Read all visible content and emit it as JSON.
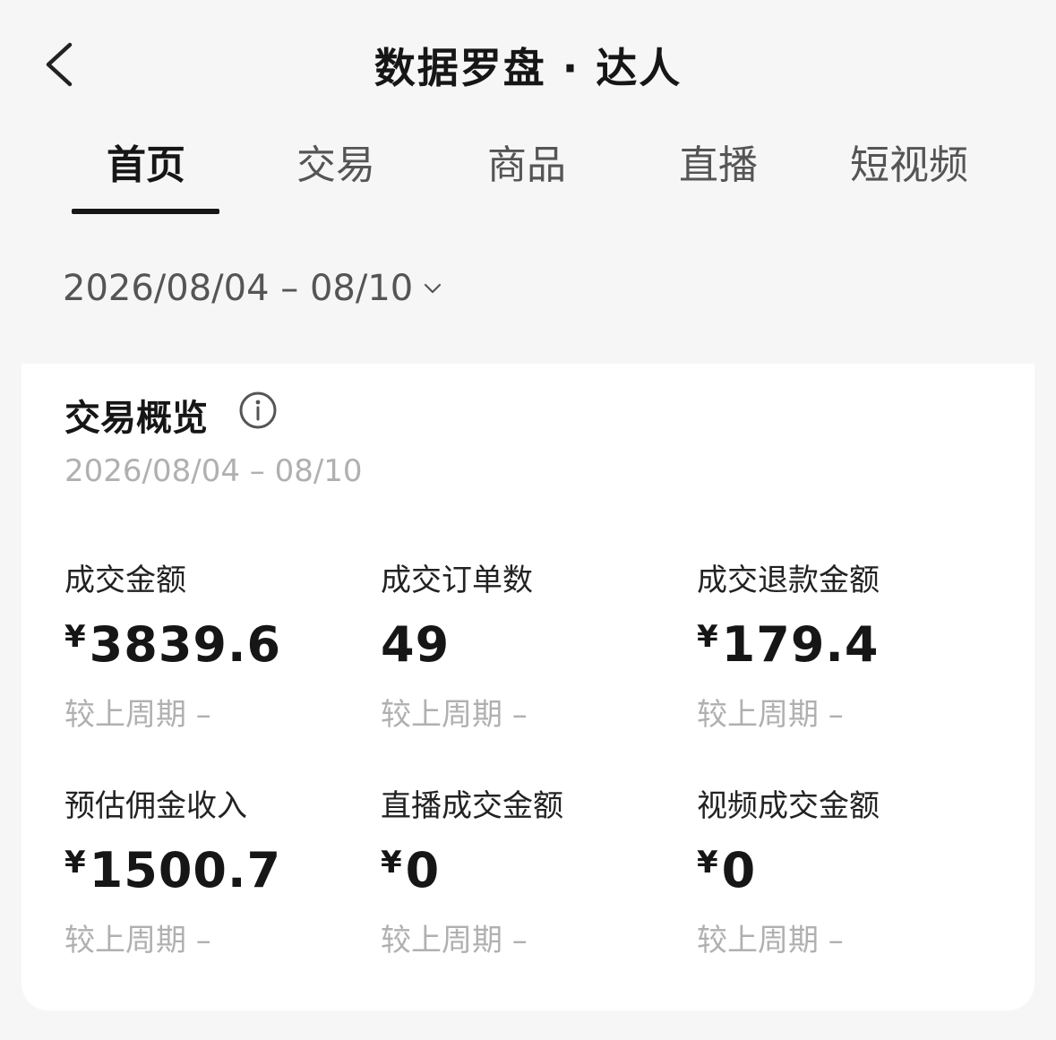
{
  "header": {
    "title": "数据罗盘 · 达人"
  },
  "tabs": [
    {
      "label": "首页",
      "active": true
    },
    {
      "label": "交易",
      "active": false
    },
    {
      "label": "商品",
      "active": false
    },
    {
      "label": "直播",
      "active": false
    },
    {
      "label": "短视频",
      "active": false
    }
  ],
  "date_range": "2026/08/04 – 08/10",
  "overview": {
    "title": "交易概览",
    "date_range": "2026/08/04 – 08/10",
    "metrics": [
      {
        "label": "成交金额",
        "currency": "¥",
        "value": "3839.6",
        "compare": "较上周期 –"
      },
      {
        "label": "成交订单数",
        "currency": "",
        "value": "49",
        "compare": "较上周期 –"
      },
      {
        "label": "成交退款金额",
        "currency": "¥",
        "value": "179.4",
        "compare": "较上周期 –"
      },
      {
        "label": "预估佣金收入",
        "currency": "¥",
        "value": "1500.7",
        "compare": "较上周期 –"
      },
      {
        "label": "直播成交金额",
        "currency": "¥",
        "value": "0",
        "compare": "较上周期 –"
      },
      {
        "label": "视频成交金额",
        "currency": "¥",
        "value": "0",
        "compare": "较上周期 –"
      }
    ]
  }
}
